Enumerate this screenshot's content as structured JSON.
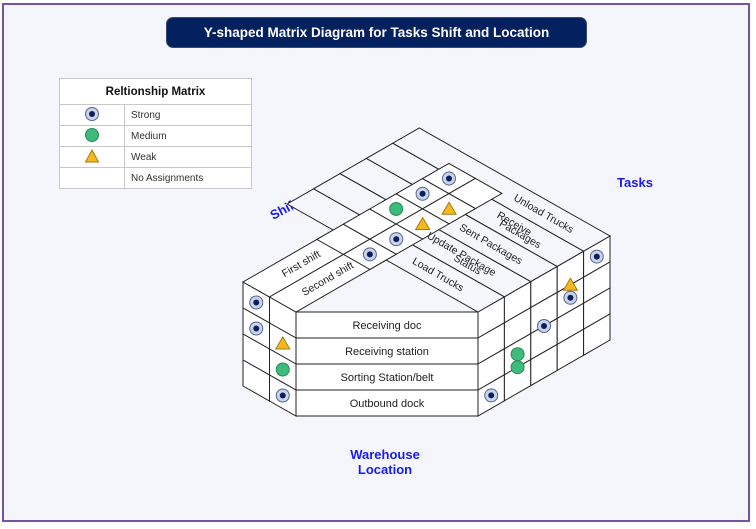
{
  "title": "Y-shaped Matrix Diagram for Tasks Shift and Location",
  "legend": {
    "heading": "Reltionship Matrix",
    "items": [
      {
        "symbol": "strong",
        "label": "Strong"
      },
      {
        "symbol": "medium",
        "label": "Medium"
      },
      {
        "symbol": "weak",
        "label": "Weak"
      },
      {
        "symbol": "none",
        "label": "No Assignments"
      }
    ]
  },
  "axis_labels": {
    "shifts": "Shifts",
    "tasks": "Tasks",
    "location": "Warehouse Location"
  },
  "colors": {
    "title_bg": "#03215e",
    "strong_outer": "#c9d3ec",
    "strong_inner": "#0b1f5c",
    "medium": "#3dbb7a",
    "weak": "#f6b81c",
    "axis_label": "#1a1aee",
    "frame": "#7a4fa8"
  },
  "shifts": [
    "First shift",
    "Second shift"
  ],
  "tasks": [
    "Load Trucks",
    "Update Package Status",
    "Sent Packages",
    "Receive Packages",
    "Unload Trucks"
  ],
  "locations": [
    "Receiving doc",
    "Receiving station",
    "Sorting Station/belt",
    "Outbound dock"
  ],
  "shift_task_matrix": [
    [
      "none",
      "none",
      "medium",
      "strong",
      "strong"
    ],
    [
      "strong",
      "strong",
      "weak",
      "weak",
      "none"
    ]
  ],
  "shift_location_matrix": [
    [
      "strong",
      "none"
    ],
    [
      "strong",
      "weak"
    ],
    [
      "none",
      "medium"
    ],
    [
      "none",
      "strong"
    ]
  ],
  "task_location_matrix": [
    [
      "none",
      "none",
      "none",
      "none",
      "strong"
    ],
    [
      "none",
      "none",
      "none",
      "weak",
      "none"
    ],
    [
      "none",
      "none",
      "none",
      "strong",
      "none"
    ],
    [
      "none",
      "none",
      "strong",
      "none",
      "none"
    ],
    [
      "none",
      "medium",
      "none",
      "none",
      "none"
    ],
    [
      "none",
      "medium",
      "none",
      "none",
      "none"
    ],
    [
      "strong",
      "none",
      "none",
      "none",
      "none"
    ]
  ]
}
